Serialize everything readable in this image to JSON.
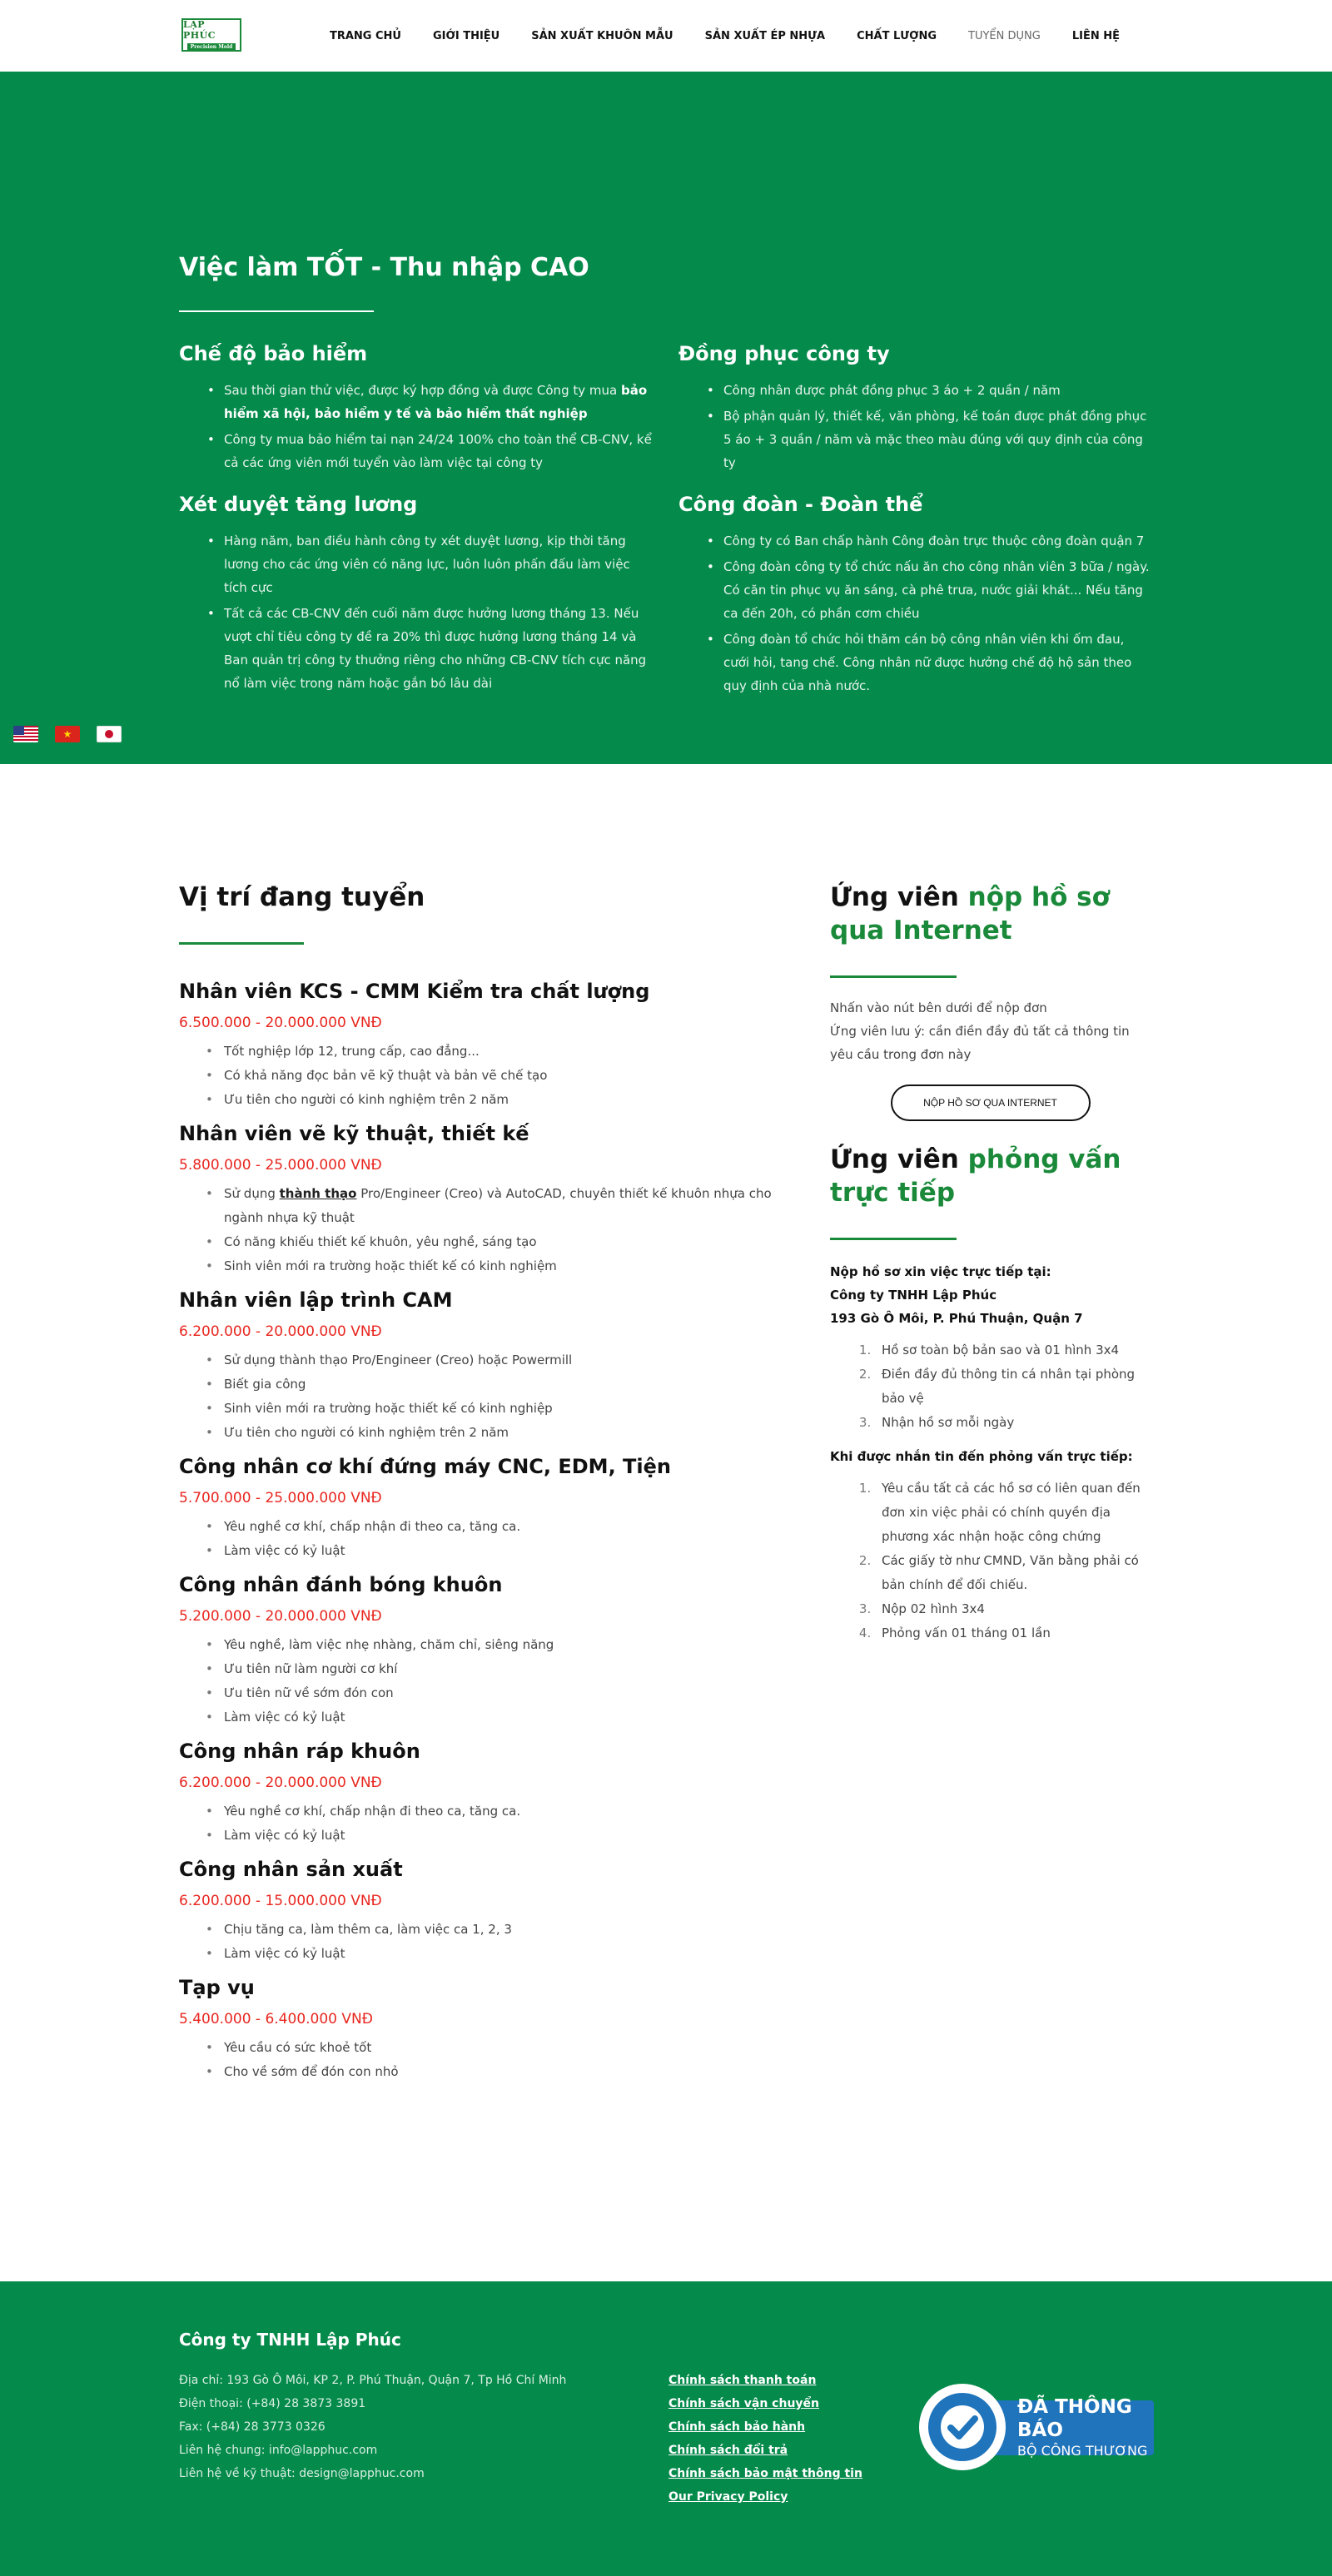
{
  "header": {
    "logo_line1": "LẬP PHÚC",
    "logo_line2": "Precision Mold",
    "nav": [
      {
        "label": "TRANG CHỦ"
      },
      {
        "label": "GIỚI THIỆU"
      },
      {
        "label": "SẢN XUẤT KHUÔN MẪU"
      },
      {
        "label": "SẢN XUẤT ÉP NHỰA"
      },
      {
        "label": "CHẤT LƯỢNG"
      },
      {
        "label": "TUYỂN DỤNG"
      },
      {
        "label": "LIÊN HỆ"
      }
    ]
  },
  "benefits": {
    "title": "Việc làm TỐT - Thu nhập CAO",
    "insurance": {
      "title": "Chế độ bảo hiểm",
      "item1_text": "Sau thời gian thử việc, được ký hợp đồng và được Công ty mua ",
      "item1_bold": "bảo hiểm xã hội, bảo hiểm y tế và bảo hiểm thất nghiệp",
      "item2": "Công ty mua bảo hiểm tai nạn 24/24 100% cho toàn thể CB-CNV, kể cả các ứng viên mới tuyển vào làm việc tại công ty"
    },
    "uniform": {
      "title": "Đồng phục công ty",
      "item1": "Công nhân được phát đồng phục 3 áo + 2 quần / năm",
      "item2": "Bộ phận quản lý, thiết kế, văn phòng, kế toán được phát đồng phục 5 áo + 3 quần / năm và mặc theo màu đúng với quy định của công ty"
    },
    "salary": {
      "title": "Xét duyệt tăng lương",
      "item1": "Hàng năm, ban điều hành công ty xét duyệt lương, kịp thời tăng lương cho các ứng viên có năng lực, luôn luôn phấn đấu làm việc tích cực",
      "item2": "Tất cả các CB-CNV đến cuối năm được hưởng lương tháng 13. Nếu vượt chỉ tiêu công ty đề ra 20% thì được hưởng lương tháng 14 và Ban quản trị công ty thưởng riêng cho những CB-CNV tích cực năng nổ làm việc trong năm hoặc gắn bó lâu dài"
    },
    "union": {
      "title": "Công đoàn - Đoàn thể",
      "item1": "Công ty có Ban chấp hành Công đoàn trực thuộc công đoàn quận 7",
      "item2": "Công đoàn công ty tổ chức nấu ăn cho công nhân viên 3 bữa / ngày. Có căn tin phục vụ ăn sáng, cà phê trưa, nước giải khát... Nếu tăng ca đến 20h, có phần cơm chiều",
      "item3": "Công đoàn tổ chức hỏi thăm cán bộ công nhân viên khi ốm đau, cưới hỏi, tang chế. Công nhân nữ được hưởng chế độ hộ sản theo quy định của nhà nước."
    }
  },
  "jobs": {
    "title": "Vị trí đang tuyển",
    "list": [
      {
        "title": "Nhân viên KCS - CMM Kiểm tra chất lượng",
        "salary": "6.500.000 - 20.000.000 VNĐ",
        "reqs": [
          "Tốt nghiệp lớp 12, trung cấp, cao đẳng...",
          "Có khả năng đọc bản vẽ kỹ thuật và bản vẽ chế tạo",
          "Ưu tiên cho người có kinh nghiệm trên 2 năm"
        ]
      },
      {
        "title": "Nhân viên vẽ kỹ thuật, thiết kế",
        "salary": "5.800.000 - 25.000.000 VNĐ",
        "req1_prefix": "Sử dụng ",
        "req1_bold": "thành thạo",
        "req1_suffix": " Pro/Engineer (Creo) và AutoCAD, chuyên thiết kế khuôn nhựa cho ngành nhựa kỹ thuật",
        "reqs": [
          "Có năng khiếu thiết kế khuôn, yêu nghề, sáng tạo",
          "Sinh viên mới ra trường hoặc thiết kế có kinh nghiệm"
        ]
      },
      {
        "title": "Nhân viên lập trình CAM",
        "salary": "6.200.000 - 20.000.000 VNĐ",
        "reqs": [
          "Sử dụng thành thạo Pro/Engineer (Creo) hoặc Powermill",
          "Biết gia công",
          "Sinh viên mới ra trường hoặc thiết kế có kinh nghiệp",
          "Ưu tiên cho người có kinh nghiệm trên 2 năm"
        ]
      },
      {
        "title": "Công nhân cơ khí đứng máy CNC, EDM, Tiện",
        "salary": "5.700.000 - 25.000.000 VNĐ",
        "reqs": [
          "Yêu nghề cơ khí, chấp nhận đi theo ca, tăng ca.",
          "Làm việc có kỷ luật"
        ]
      },
      {
        "title": "Công nhân đánh bóng khuôn",
        "salary": "5.200.000 - 20.000.000 VNĐ",
        "reqs": [
          "Yêu nghề, làm việc nhẹ nhàng, chăm chỉ, siêng năng",
          "Ưu tiên nữ làm người cơ khí",
          "Ưu tiên nữ về sớm đón con",
          "Làm việc có kỷ luật"
        ]
      },
      {
        "title": "Công nhân ráp khuôn",
        "salary": "6.200.000 - 20.000.000 VNĐ",
        "reqs": [
          "Yêu nghề cơ khí, chấp nhận đi theo ca, tăng ca.",
          "Làm việc có kỷ luật"
        ]
      },
      {
        "title": "Công nhân sản xuất",
        "salary": "6.200.000 - 15.000.000 VNĐ",
        "reqs": [
          "Chịu tăng ca, làm thêm ca, làm việc ca 1, 2, 3",
          "Làm việc có kỷ luật"
        ]
      },
      {
        "title": "Tạp vụ",
        "salary": "5.400.000 - 6.400.000 VNĐ",
        "reqs": [
          "Yêu cầu có sức khoẻ tốt",
          "Cho về sớm để đón con nhỏ"
        ]
      }
    ]
  },
  "apply": {
    "online_title_1": "Ứng viên ",
    "online_title_2": "nộp hồ sơ qua Internet",
    "online_p1": "Nhấn vào nút bên dưới để nộp đơn",
    "online_p2": "Ứng viên lưu ý: cần điền đầy đủ tất cả thông tin yêu cầu trong đơn này",
    "button": "NỘP HỒ SƠ QUA INTERNET",
    "direct_title_1": "Ứng viên ",
    "direct_title_2": "phỏng vấn trực tiếp",
    "addr1": "Nộp hồ sơ xin việc trực tiếp tại:",
    "addr2": "Công ty TNHH Lập Phúc",
    "addr3": "193 Gò Ô Môi, P. Phú Thuận, Quận 7",
    "docs": [
      "Hồ sơ toàn bộ bản sao và 01 hình 3x4",
      "Điền đầy đủ thông tin cá nhân tại phòng bảo vệ",
      "Nhận hồ sơ mỗi ngày"
    ],
    "interview_head": "Khi được nhắn tin đến phỏng vấn trực tiếp:",
    "interview": [
      "Yêu cầu tất cả các hồ sơ có liên quan đến đơn xin việc phải có chính quyền địa phương xác nhận hoặc công chứng",
      "Các giấy tờ như CMND, Văn bằng phải có bản chính để đối chiếu.",
      "Nộp 02 hình 3x4",
      "Phỏng vấn 01 tháng 01 lần"
    ]
  },
  "footer": {
    "company": "Công ty TNHH Lập Phúc",
    "address": "Địa chỉ: 193 Gò Ô Môi, KP 2, P. Phú Thuận, Quận 7, Tp Hồ Chí Minh",
    "phone": "Điện thoại: (+84) 28 3873 3891",
    "fax": "Fax: (+84) 28 3773 0326",
    "email_general": "Liên hệ chung: info@lapphuc.com",
    "email_tech": "Liên hệ về kỹ thuật: design@lapphuc.com",
    "links": [
      "Chính sách thanh toán",
      "Chính sách vận chuyển",
      "Chính sách bảo hành",
      "Chính sách đổi trả",
      "Chính sách bảo mật thông tin",
      "Our Privacy Policy"
    ],
    "badge_line1": "ĐÃ THÔNG BÁO",
    "badge_line2": "BỘ CÔNG THƯƠNG"
  }
}
